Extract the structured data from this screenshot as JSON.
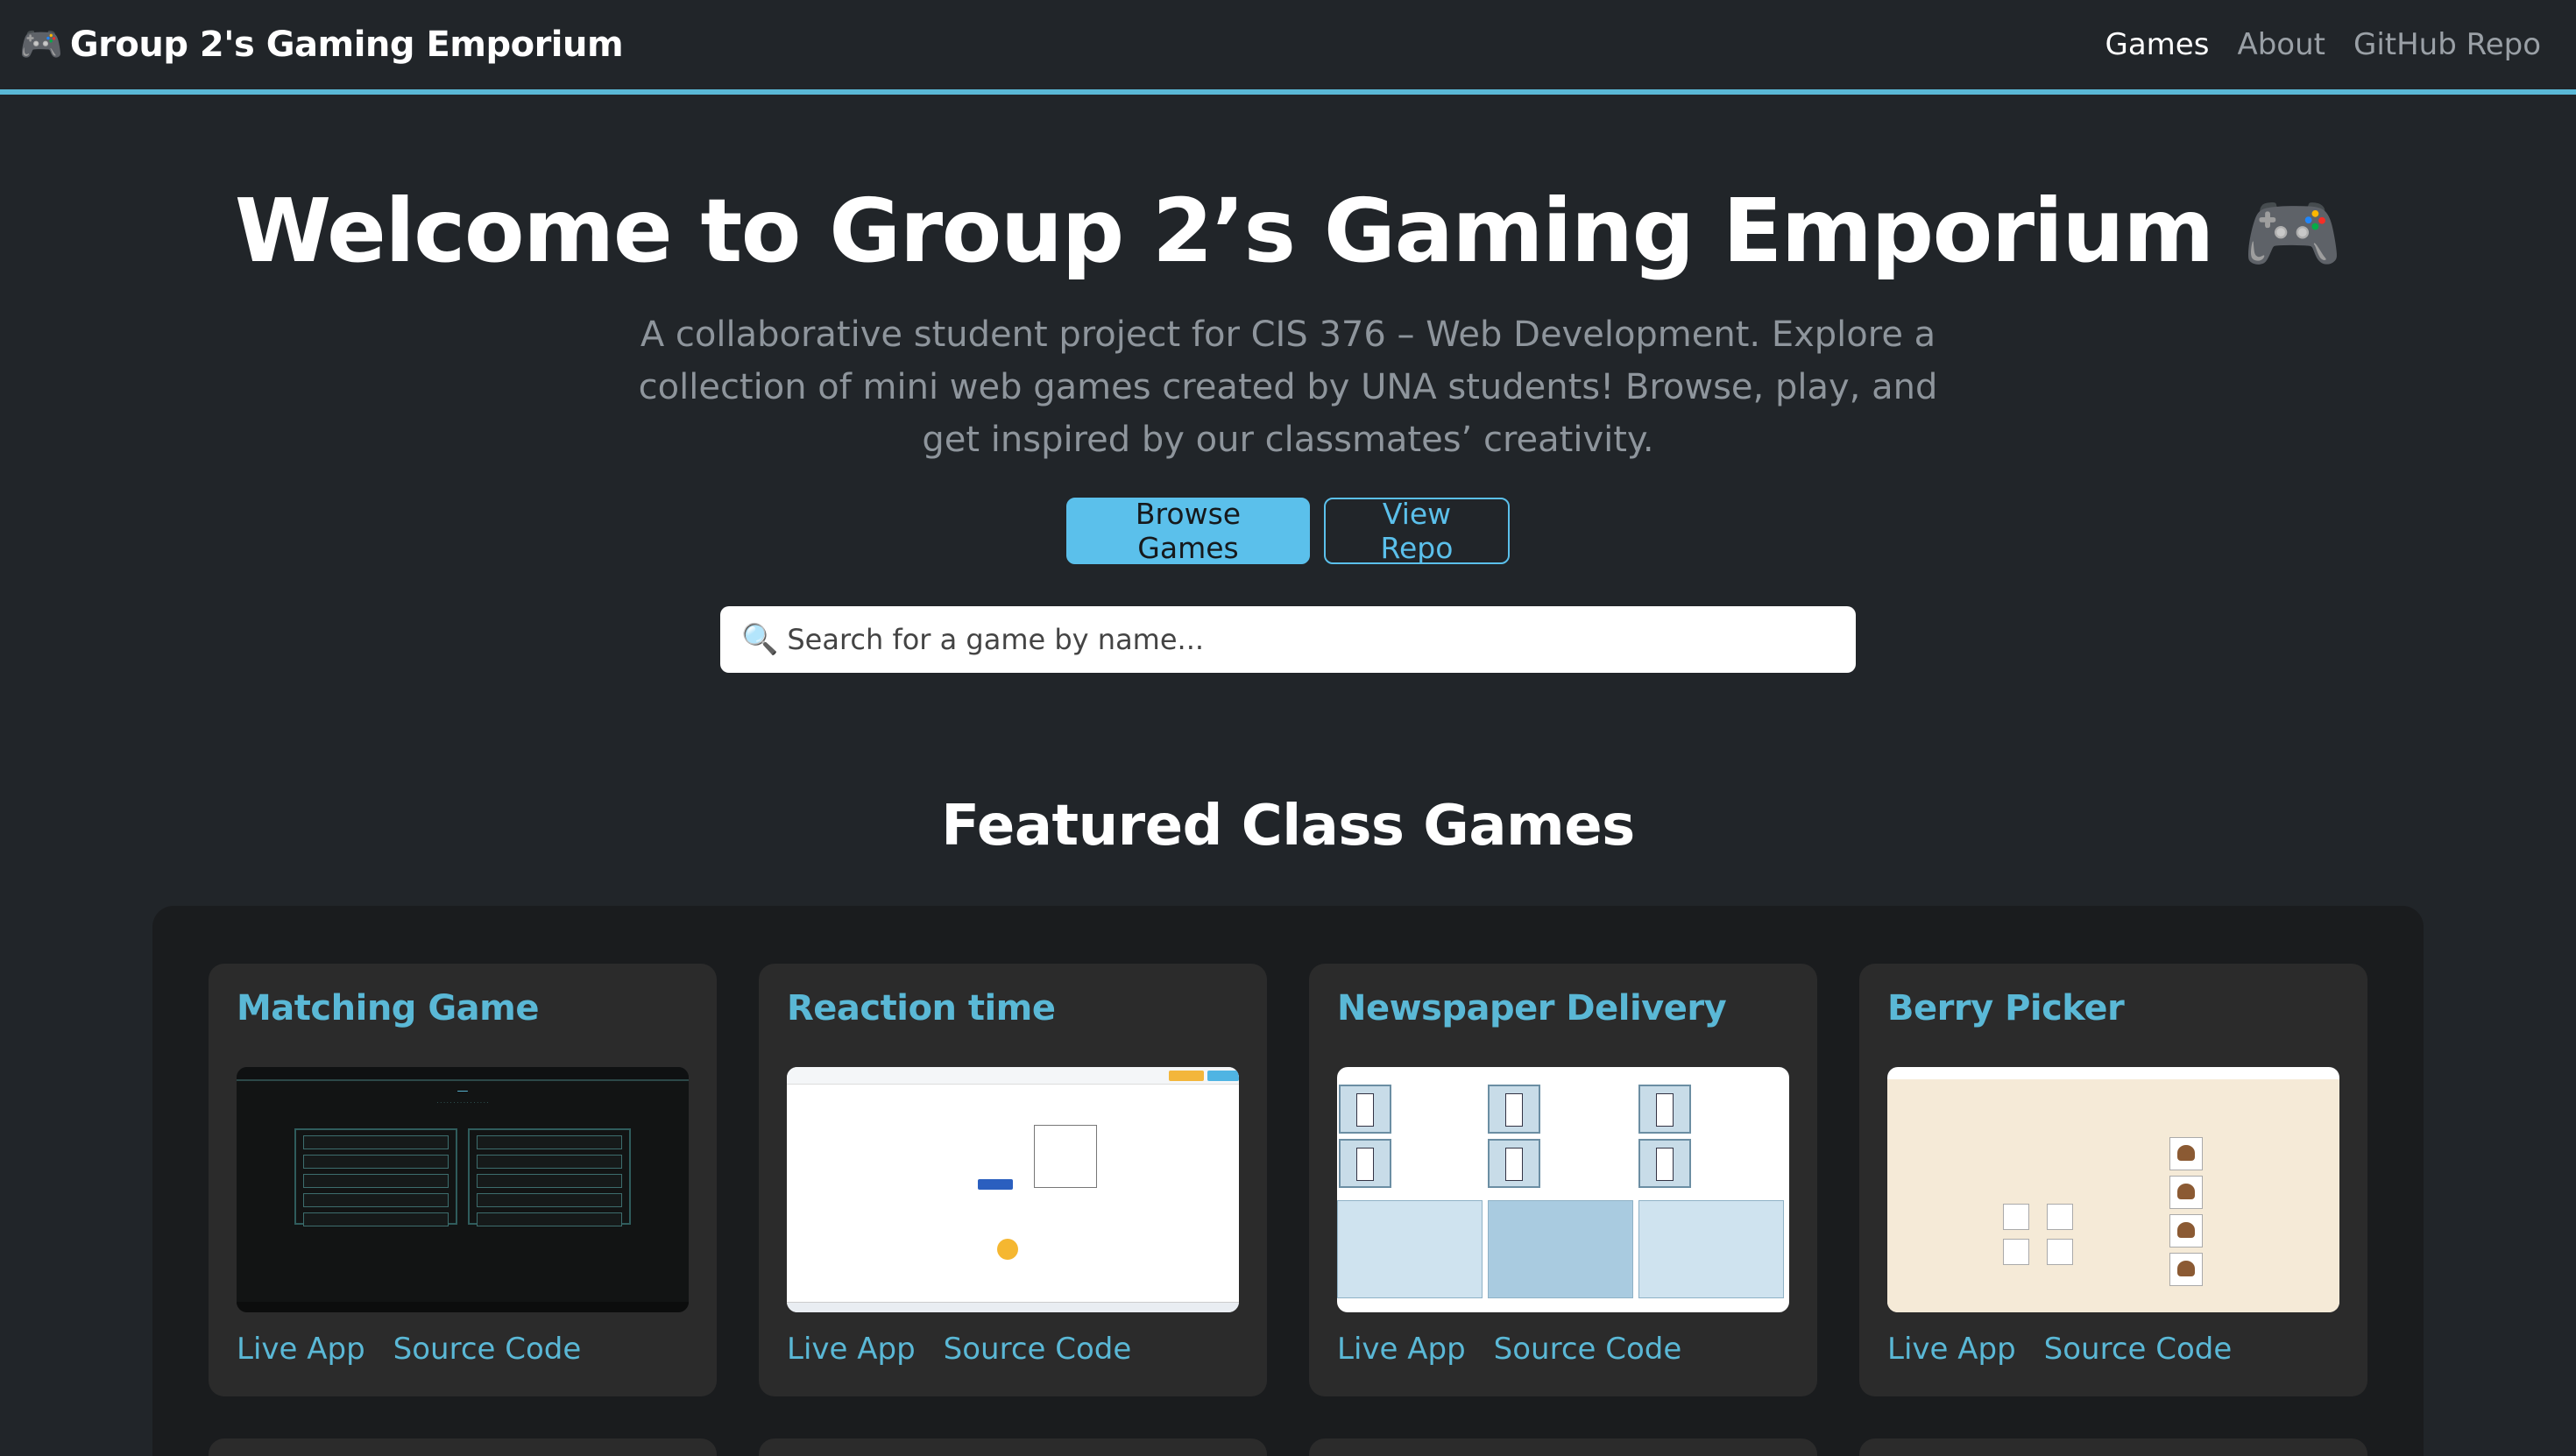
{
  "navbar": {
    "brand_emoji": "🎮",
    "brand": "Group 2's Gaming Emporium",
    "links": [
      {
        "label": "Games",
        "active": true
      },
      {
        "label": "About",
        "active": false
      },
      {
        "label": "GitHub Repo",
        "active": false
      }
    ]
  },
  "hero": {
    "title": "Welcome to Group 2’s Gaming Emporium",
    "title_emoji": "🎮",
    "description": "A collaborative student project for CIS 376 – Web Development. Explore a collection of mini web games created by UNA students! Browse, play, and get inspired by our classmates’ creativity.",
    "browse_label": "Browse Games",
    "repo_label": "View Repo"
  },
  "search": {
    "icon": "🔍",
    "placeholder": "Search for a game by name...",
    "value": ""
  },
  "featured": {
    "title": "Featured Class Games",
    "games": [
      {
        "title": "Matching Game",
        "live_label": "Live App",
        "source_label": "Source Code"
      },
      {
        "title": "Reaction time",
        "live_label": "Live App",
        "source_label": "Source Code"
      },
      {
        "title": "Newspaper Delivery",
        "live_label": "Live App",
        "source_label": "Source Code"
      },
      {
        "title": "Berry Picker",
        "live_label": "Live App",
        "source_label": "Source Code"
      }
    ]
  },
  "colors": {
    "accent": "#5ab8d6",
    "background": "#212529",
    "panel": "#1a1c1e",
    "card": "#2b2b2b"
  }
}
